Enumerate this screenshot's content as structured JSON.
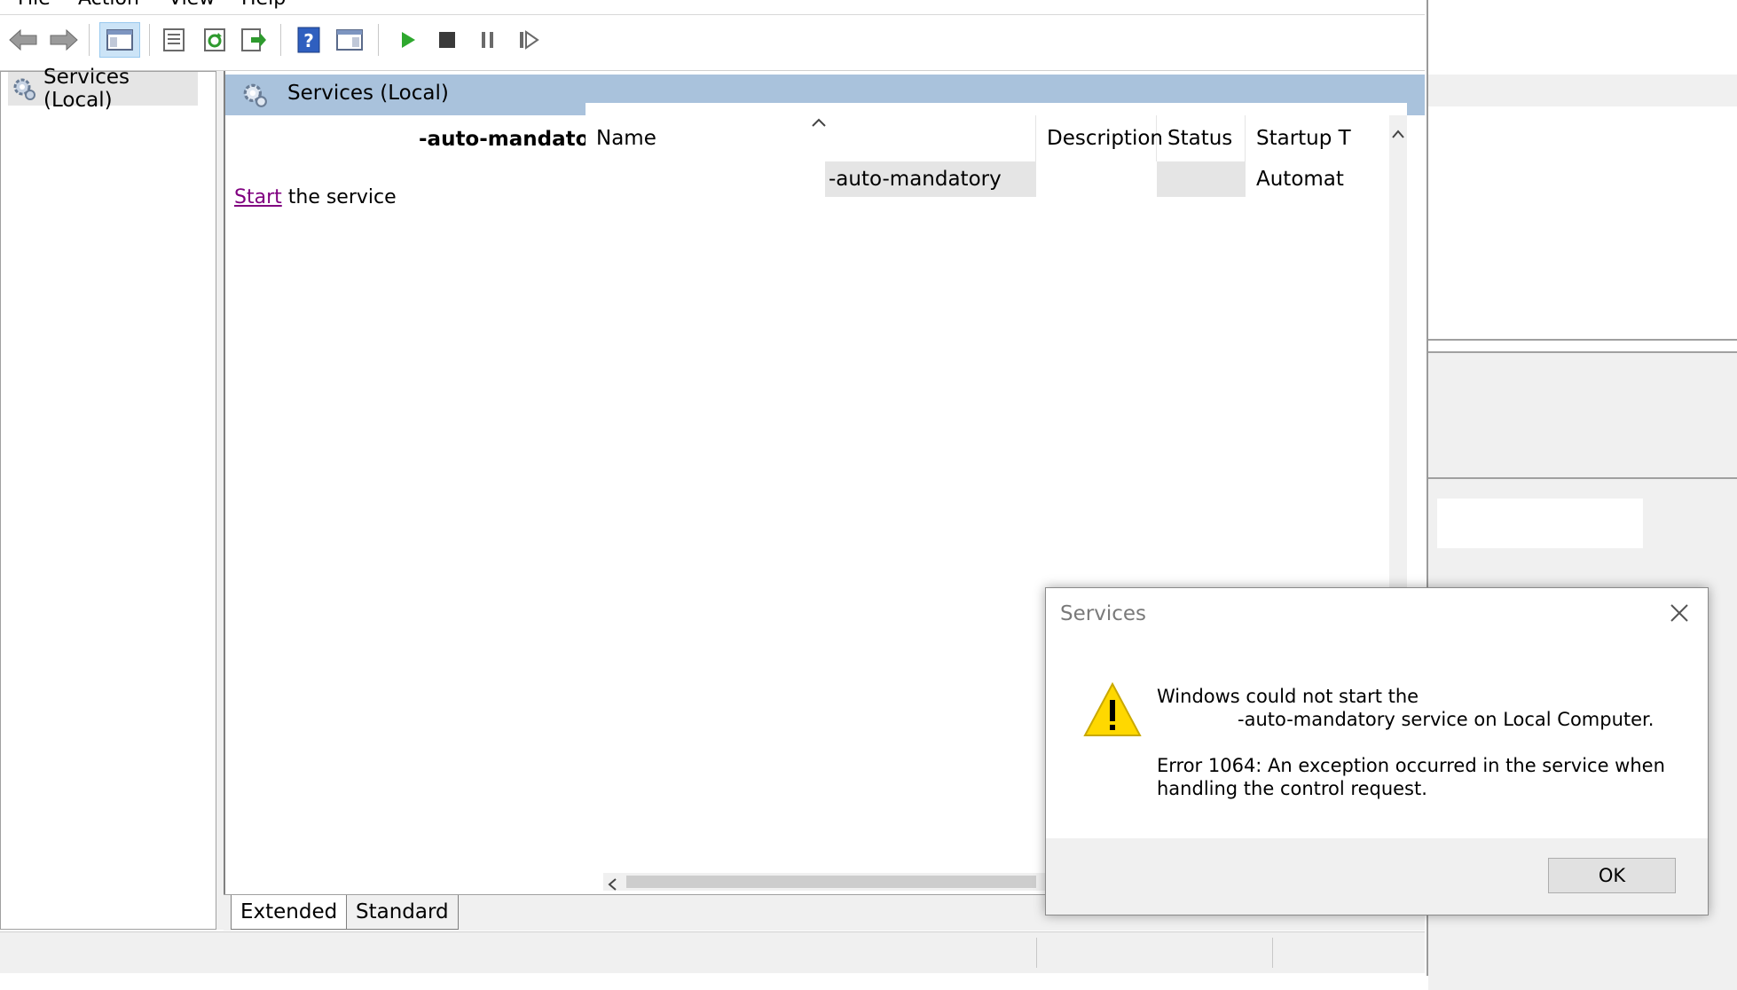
{
  "menu": {
    "items": [
      "File",
      "Action",
      "View",
      "Help"
    ]
  },
  "toolbar": {
    "buttons": [
      "back-icon",
      "forward-icon",
      "show-hide-console-tree-icon",
      "properties-icon",
      "refresh-icon",
      "export-list-icon",
      "help-icon",
      "show-hide-action-pane-icon",
      "start-service-icon",
      "stop-service-icon",
      "pause-service-icon",
      "resume-service-icon"
    ]
  },
  "tree": {
    "root_label": "Services (Local)"
  },
  "pane": {
    "header_title": "Services (Local)",
    "service_name": "-auto-mandatory",
    "start_link": "Start",
    "start_suffix": " the service"
  },
  "list": {
    "columns": {
      "name": "Name",
      "description": "Description",
      "status": "Status",
      "startup": "Startup T"
    },
    "rows": [
      {
        "name": "-auto-mandatory",
        "description": "",
        "status": "",
        "startup": "Automat"
      }
    ]
  },
  "tabs": {
    "extended": "Extended",
    "standard": "Standard"
  },
  "dialog": {
    "title": "Services",
    "line1": "Windows could not start the",
    "line2": "-auto-mandatory service on Local Computer.",
    "line3": "Error 1064: An exception occurred in the service when",
    "line4": "handling the control request.",
    "ok_label": "OK"
  },
  "colors": {
    "header_band": "#a9c2dc",
    "link": "#800080",
    "start_icon": "#2ea82e",
    "warning": "#ffd800"
  }
}
